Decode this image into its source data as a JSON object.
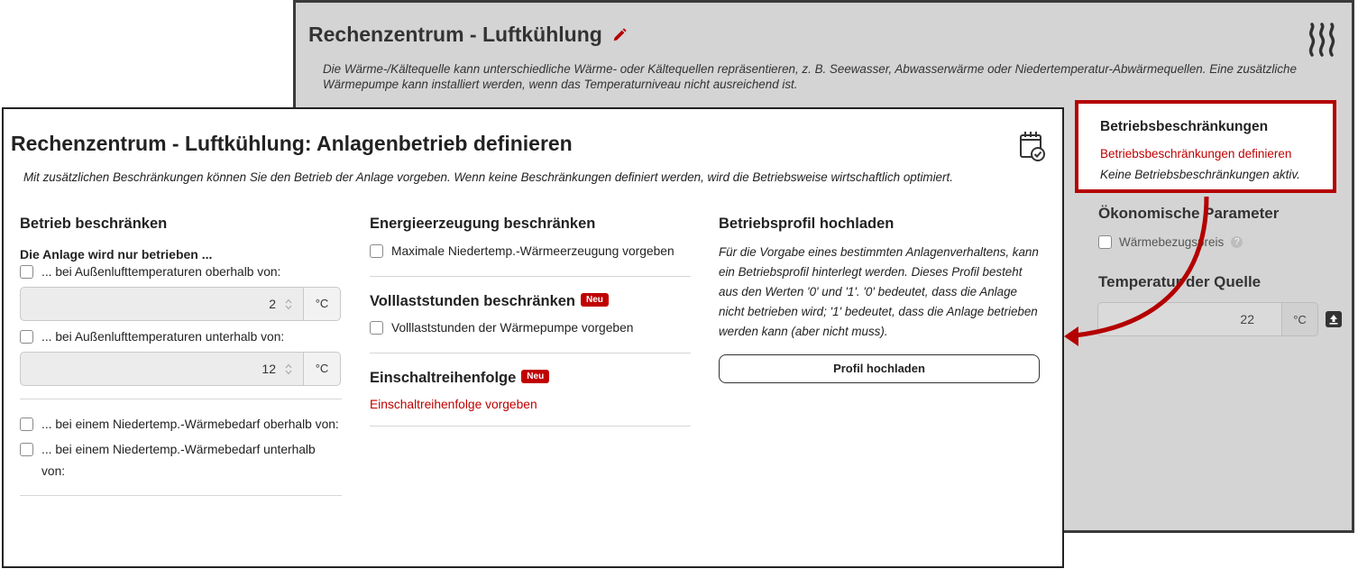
{
  "background_window": {
    "title": "Rechenzentrum - Luftkühlung",
    "description": "Die Wärme-/Kältequelle kann unterschiedliche Wärme- oder Kältequellen repräsentieren, z. B. Seewasser, Abwasserwärme oder Niedertemperatur-Abwärmequellen. Eine zusätzliche Wärmepumpe kann installiert werden, wenn das Temperaturniveau nicht ausreichend ist.",
    "restrictions": {
      "title": "Betriebsbeschränkungen",
      "link": "Betriebsbeschränkungen definieren",
      "status": "Keine Betriebsbeschränkungen aktiv."
    },
    "economics": {
      "title": "Ökonomische Parameter",
      "checkbox_label": "Wärmebezugspreis"
    },
    "source_temperature": {
      "title": "Temperatur der Quelle",
      "value": "22",
      "unit": "°C"
    }
  },
  "dialog": {
    "title": "Rechenzentrum - Luftkühlung: Anlagenbetrieb definieren",
    "description": "Mit zusätzlichen Beschränkungen können Sie den Betrieb der Anlage vorgeben. Wenn keine Beschränkungen definiert werden, wird die Betriebsweise wirtschaftlich optimiert.",
    "restrict_operation": {
      "title": "Betrieb beschränken",
      "subtitle": "Die Anlage wird nur betrieben ...",
      "above_outdoor_label": "... bei Außenlufttemperaturen oberhalb von:",
      "above_outdoor_value": "2",
      "below_outdoor_label": "... bei Außenlufttemperaturen unterhalb von:",
      "below_outdoor_value": "12",
      "unit": "°C",
      "demand_above_label": "... bei einem Niedertemp.-Wärmebedarf oberhalb von:",
      "demand_below_label": "... bei einem Niedertemp.-Wärmebedarf unterhalb von:"
    },
    "energy_generation": {
      "title": "Energieerzeugung beschränken",
      "max_heat_label": "Maximale Niedertemp.-Wärmeerzeugung vorgeben"
    },
    "full_load_hours": {
      "title": "Volllaststunden beschränken",
      "badge": "Neu",
      "label": "Volllaststunden der Wärmepumpe vorgeben"
    },
    "switch_order": {
      "title": "Einschaltreihenfolge",
      "badge": "Neu",
      "link": "Einschaltreihenfolge vorgeben"
    },
    "profile_upload": {
      "title": "Betriebsprofil hochladen",
      "text": "Für die Vorgabe eines bestimmten Anlagenverhaltens, kann ein Betriebsprofil hinterlegt werden. Dieses Profil besteht aus den Werten '0' und '1'. '0' bedeutet, dass die Anlage nicht betrieben wird; '1' bedeutet, dass die Anlage betrieben werden kann (aber nicht muss).",
      "button": "Profil hochladen"
    }
  },
  "colors": {
    "accent_red": "#c00000",
    "highlight_border": "#b40000",
    "background_grey": "#d4d4d4"
  },
  "icons": [
    "pencil-icon",
    "heat-icon",
    "calendar-check-icon",
    "help-icon",
    "upload-icon",
    "spinner-icon"
  ]
}
